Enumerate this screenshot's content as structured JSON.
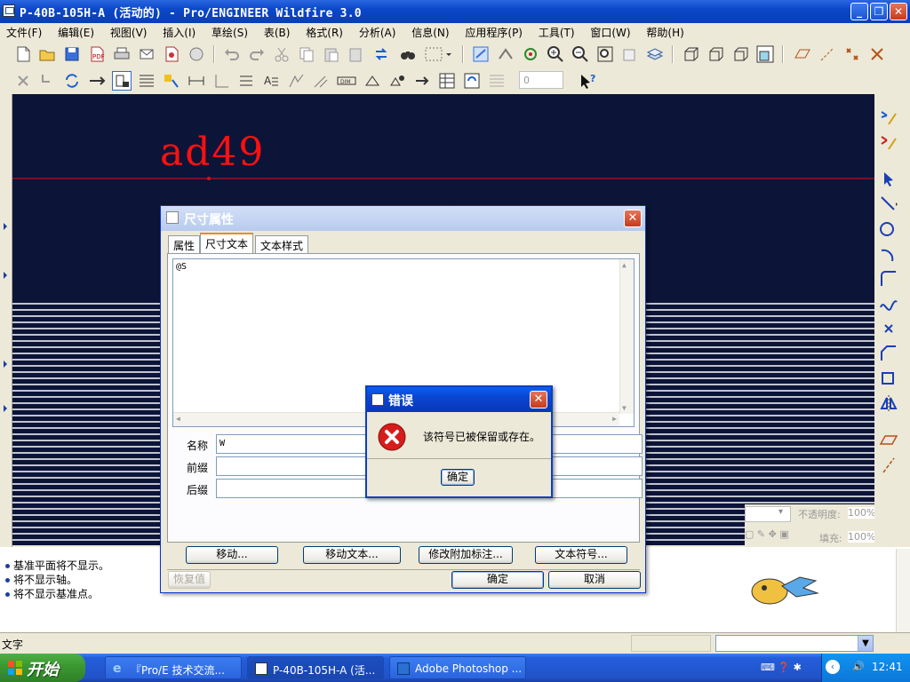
{
  "window": {
    "title": "P-40B-105H-A (活动的) - Pro/ENGINEER Wildfire 3.0",
    "minimize": "_",
    "maximize": "❐",
    "close": "✕"
  },
  "menu": [
    "文件(F)",
    "编辑(E)",
    "视图(V)",
    "插入(I)",
    "草绘(S)",
    "表(B)",
    "格式(R)",
    "分析(A)",
    "信息(N)",
    "应用程序(P)",
    "工具(T)",
    "窗口(W)",
    "帮助(H)"
  ],
  "toolbar": {
    "spin_value": "0"
  },
  "canvas": {
    "drawing_text": "ad49",
    "opacity_label": "不透明度:",
    "opacity_value": "100%",
    "fill_label": "填充:",
    "fill_value": "100%"
  },
  "messages": [
    "基准平面将不显示。",
    "将不显示轴。",
    "将不显示基准点。"
  ],
  "status": {
    "text": "文字"
  },
  "dim_dialog": {
    "title": "尺寸属性",
    "tabs": [
      "属性",
      "尺寸文本",
      "文本样式"
    ],
    "selected_tab": 1,
    "text_content": "@S",
    "name_label": "名称",
    "name_value": "W",
    "prefix_label": "前缀",
    "prefix_value": "",
    "suffix_label": "后缀",
    "suffix_value": "",
    "buttons": {
      "move": "移动...",
      "move_text": "移动文本...",
      "modify_attach": "修改附加标注...",
      "text_symbol": "文本符号...",
      "restore": "恢复值",
      "ok": "确定",
      "cancel": "取消"
    }
  },
  "error_dialog": {
    "title": "错误",
    "message": "该符号已被保留或存在。",
    "ok": "确定"
  },
  "taskbar": {
    "start": "开始",
    "items": [
      "『Pro/E 技术交流...",
      "P-40B-105H-A (活...",
      "Adobe Photoshop ..."
    ],
    "clock": "12:41"
  },
  "colors": {
    "canvas_bg": "#0c1438",
    "drawing_red": "#ff1010",
    "xp_blue": "#0a46d2"
  }
}
